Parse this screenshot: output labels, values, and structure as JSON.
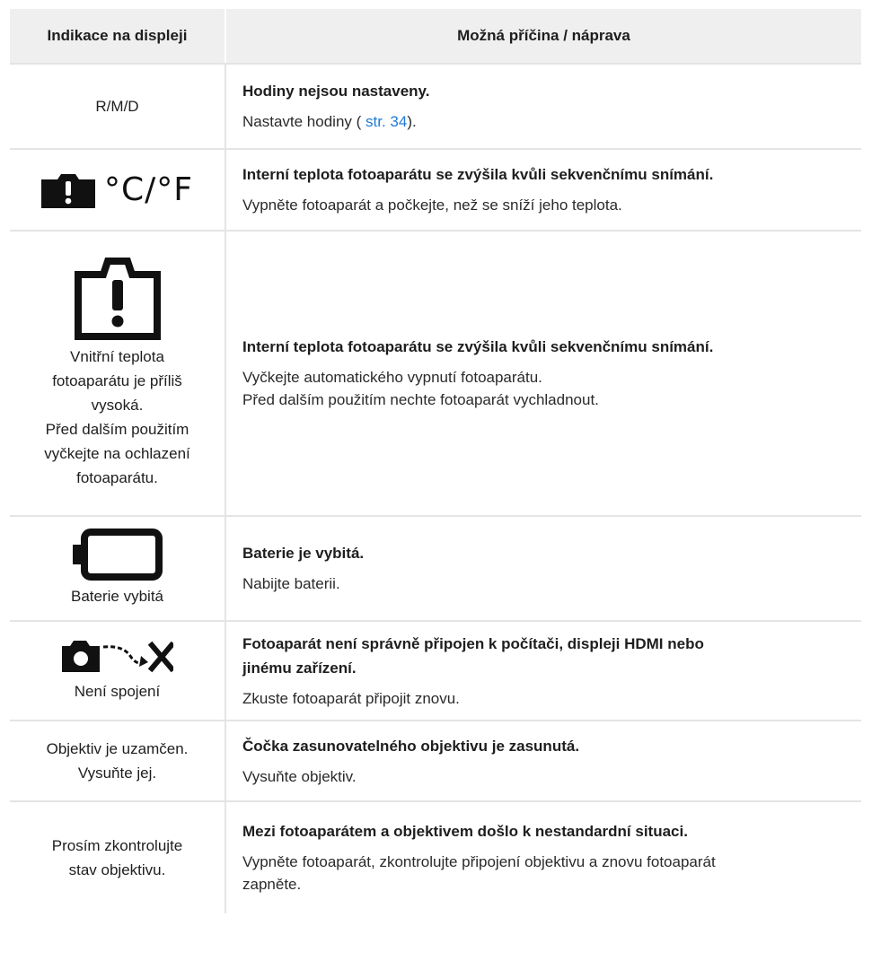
{
  "header": {
    "col1": "Indikace na displeji",
    "col2": "Možná příčina / náprava"
  },
  "rows": [
    {
      "indicator_text": [
        "R/M/D"
      ],
      "cause_title": "Hodiny nejsou nastaveny.",
      "remedy_prefix": "Nastavte hodiny ( ",
      "remedy_link": "str. 34",
      "remedy_suffix": ")."
    },
    {
      "indicator_icon": "camera-warning-icon",
      "indicator_symbol": "°C/°F",
      "cause_title": "Interní teplota fotoaparátu se zvýšila kvůli sekvenčnímu snímání.",
      "remedy_lines": [
        "Vypněte fotoaparát a počkejte, než se sníží jeho teplota."
      ]
    },
    {
      "indicator_icon": "camera-exclamation-icon",
      "indicator_text": [
        "Vnitřní teplota",
        "fotoaparátu je příliš",
        "vysoká.",
        "Před dalším použitím",
        "vyčkejte na ochlazení",
        "fotoaparátu."
      ],
      "cause_title": "Interní teplota fotoaparátu se zvýšila kvůli sekvenčnímu snímání.",
      "remedy_lines": [
        "Vyčkejte automatického vypnutí fotoaparátu.",
        "Před dalším použitím nechte fotoaparát vychladnout."
      ]
    },
    {
      "indicator_icon": "empty-battery-icon",
      "indicator_text": [
        "Baterie vybitá"
      ],
      "cause_title": "Baterie je vybitá.",
      "remedy_lines": [
        "Nabijte baterii."
      ]
    },
    {
      "indicator_icon": "camera-no-connection-icon",
      "indicator_text": [
        "Není spojení"
      ],
      "cause_title_lines": [
        "Fotoaparát není správně připojen k počítači, displeji HDMI nebo",
        "jinému zařízení."
      ],
      "remedy_lines": [
        "Zkuste fotoaparát připojit znovu."
      ]
    },
    {
      "indicator_text": [
        "Objektiv je uzamčen.",
        "Vysuňte jej."
      ],
      "cause_title": "Čočka zasunovatelného objektivu je zasunutá.",
      "remedy_lines": [
        "Vysuňte objektiv."
      ]
    },
    {
      "indicator_text": [
        "Prosím zkontrolujte",
        "stav objektivu."
      ],
      "cause_title": "Mezi fotoaparátem a objektivem došlo k nestandardní situaci.",
      "remedy_lines": [
        "Vypněte fotoaparát, zkontrolujte připojení objektivu a znovu fotoaparát",
        "zapněte."
      ]
    }
  ],
  "colors": {
    "header_bg": "#efefef",
    "grid": "#e4e4e4",
    "link": "#1f7ad8"
  }
}
